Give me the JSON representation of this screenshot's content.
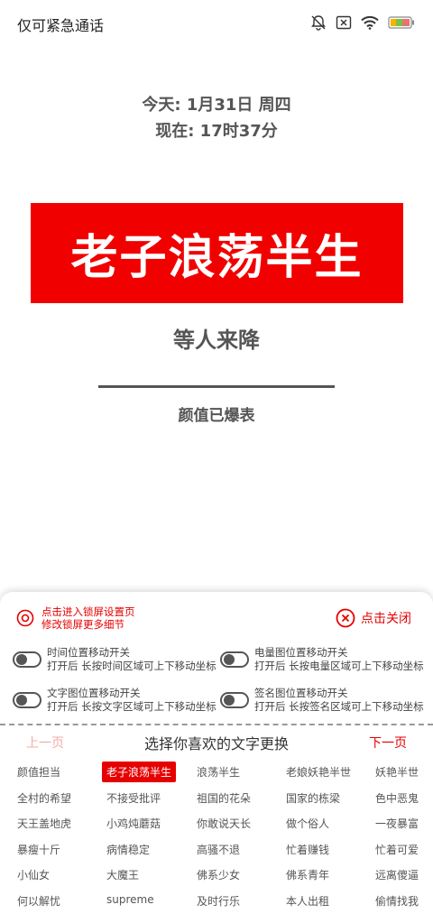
{
  "status_bar": {
    "carrier": "仅可紧急通话",
    "icons": [
      "bell-muted-icon",
      "sim-x-icon",
      "wifi-icon",
      "battery-icon"
    ]
  },
  "lock_screen": {
    "today": "今天: 1月31日 周四",
    "now": "现在: 17时37分",
    "banner_text": "老子浪荡半生",
    "signature": "等人来降",
    "subtext": "颜值已爆表"
  },
  "panel": {
    "lock_settings_line1": "点击进入锁屏设置页",
    "lock_settings_line2": "修改锁屏更多细节",
    "close_label": "点击关闭",
    "toggles": [
      {
        "title": "时间位置移动开关",
        "desc": "打开后  长按时间区域可上下移动坐标"
      },
      {
        "title": "电量图位置移动开关",
        "desc": "打开后  长按电量区域可上下移动坐标"
      },
      {
        "title": "文字图位置移动开关",
        "desc": "打开后  长按文字区域可上下移动坐标"
      },
      {
        "title": "签名图位置移动开关",
        "desc": "打开后  长按签名区域可上下移动坐标"
      }
    ],
    "prev_label": "上一页",
    "grid_title": "选择你喜欢的文字更换",
    "next_label": "下一页",
    "selected_word": "老子浪荡半生",
    "words": [
      [
        "颜值担当",
        "老子浪荡半生",
        "浪荡半生",
        "老娘妖艳半世",
        "妖艳半世"
      ],
      [
        "全村的希望",
        "不接受批评",
        "祖国的花朵",
        "国家的栋梁",
        "色中恶鬼"
      ],
      [
        "天王盖地虎",
        "小鸡炖蘑菇",
        "你敢说天长",
        "做个俗人",
        "一夜暴富"
      ],
      [
        "暴瘦十斤",
        "病情稳定",
        "高骚不退",
        "忙着赚钱",
        "忙着可爱"
      ],
      [
        "小仙女",
        "大魔王",
        "佛系少女",
        "佛系青年",
        "远离傻逼"
      ],
      [
        "何以解忧",
        "supreme",
        "及时行乐",
        "本人出租",
        "偷情找我"
      ]
    ]
  },
  "colors": {
    "accent": "#e60000",
    "banner_bg": "#f10000",
    "text_gray": "#555555"
  }
}
